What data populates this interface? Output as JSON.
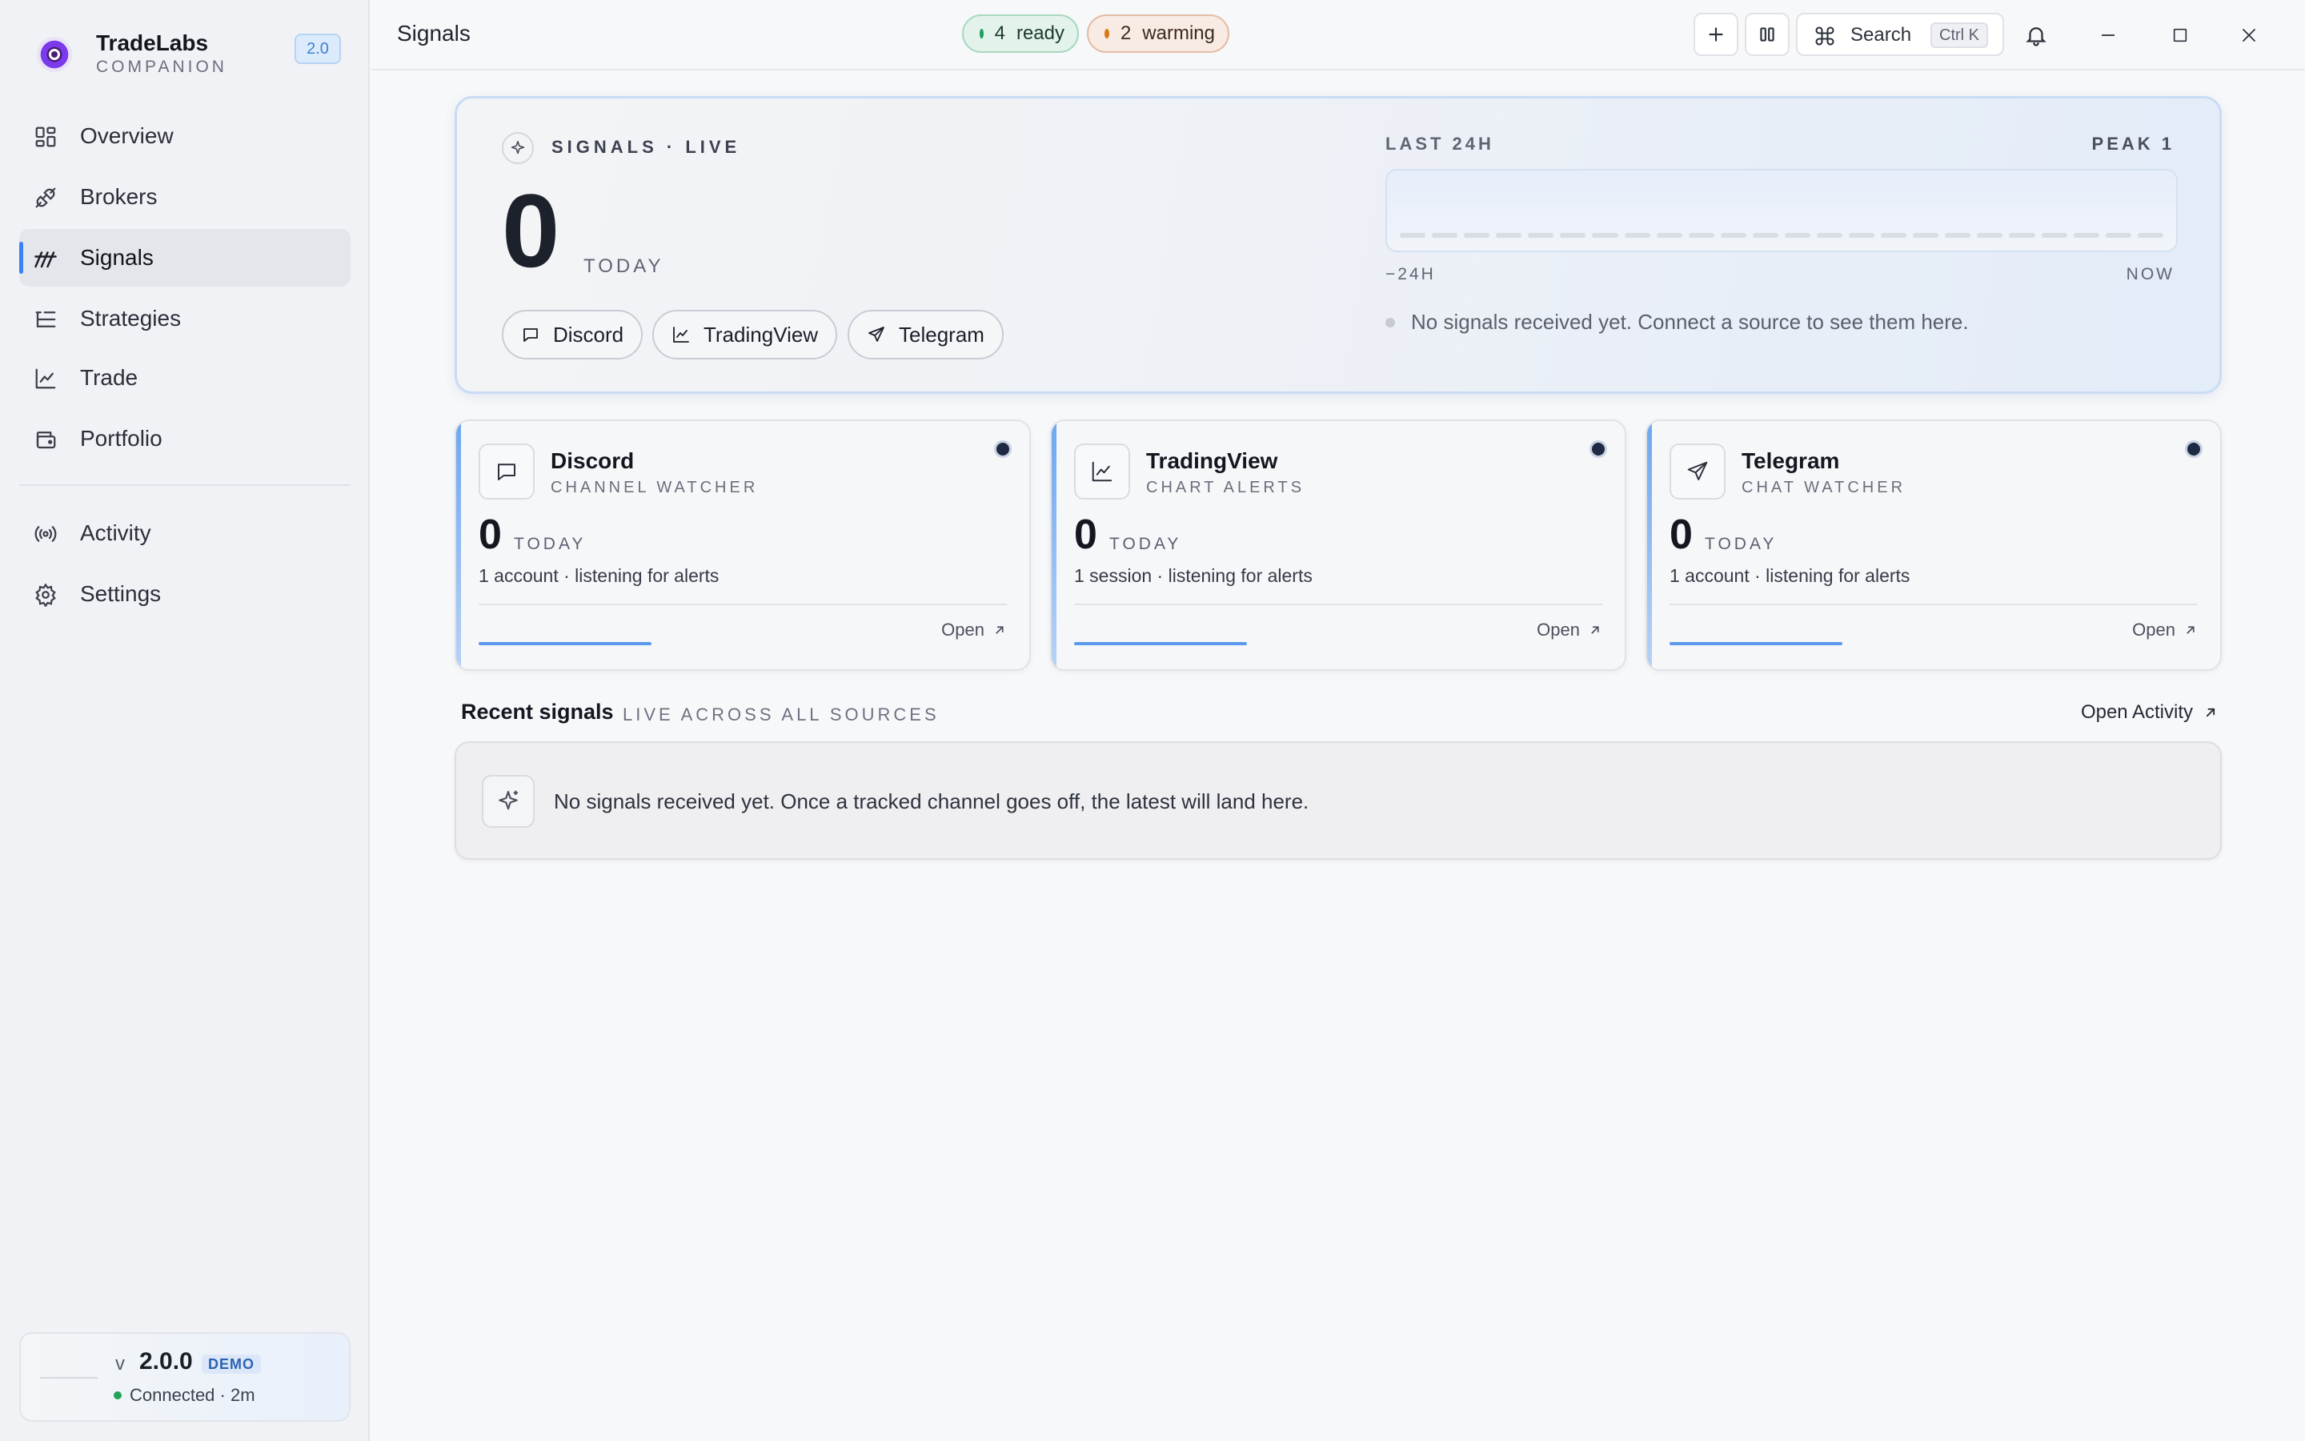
{
  "brand": {
    "title": "TradeLabs",
    "subtitle": "COMPANION",
    "version_badge": "2.0"
  },
  "sidebar": {
    "items": [
      {
        "label": "Overview",
        "icon": "grid-icon"
      },
      {
        "label": "Brokers",
        "icon": "plug-icon"
      },
      {
        "label": "Signals",
        "icon": "signal-icon",
        "active": true
      },
      {
        "label": "Strategies",
        "icon": "list-tree-icon"
      },
      {
        "label": "Trade",
        "icon": "chart-line-icon"
      },
      {
        "label": "Portfolio",
        "icon": "wallet-icon"
      },
      {
        "label": "Activity",
        "icon": "broadcast-icon"
      },
      {
        "label": "Settings",
        "icon": "gear-icon"
      }
    ],
    "version": {
      "prefix": "v",
      "number": "2.0.0",
      "badge": "DEMO",
      "status": "Connected · 2m"
    }
  },
  "topbar": {
    "title": "Signals",
    "ready": {
      "count": "4",
      "label": "ready"
    },
    "warming": {
      "count": "2",
      "label": "warming"
    },
    "search": {
      "label": "Search",
      "shortcut": "Ctrl K"
    }
  },
  "hero": {
    "label": "SIGNALS · LIVE",
    "count": "0",
    "count_unit": "TODAY",
    "sources": [
      "Discord",
      "TradingView",
      "Telegram"
    ],
    "window_label": "LAST 24H",
    "peak": "PEAK 1",
    "axis_start": "−24H",
    "axis_end": "NOW",
    "empty_message": "No signals received yet. Connect a source to see them here."
  },
  "cards": [
    {
      "title": "Discord",
      "subtitle": "CHANNEL WATCHER",
      "count": "0",
      "unit": "TODAY",
      "detail": "1 account · listening for alerts",
      "action": "Open"
    },
    {
      "title": "TradingView",
      "subtitle": "CHART ALERTS",
      "count": "0",
      "unit": "TODAY",
      "detail": "1 session · listening for alerts",
      "action": "Open"
    },
    {
      "title": "Telegram",
      "subtitle": "CHAT WATCHER",
      "count": "0",
      "unit": "TODAY",
      "detail": "1 account · listening for alerts",
      "action": "Open"
    }
  ],
  "recent": {
    "title": "Recent signals",
    "subtitle": "LIVE ACROSS ALL SOURCES",
    "action": "Open Activity",
    "empty_message": "No signals received yet. Once a tracked channel goes off, the latest will land here."
  },
  "colors": {
    "accent": "#3b82f6",
    "ready": "#1fa061",
    "warming": "#d97917"
  }
}
